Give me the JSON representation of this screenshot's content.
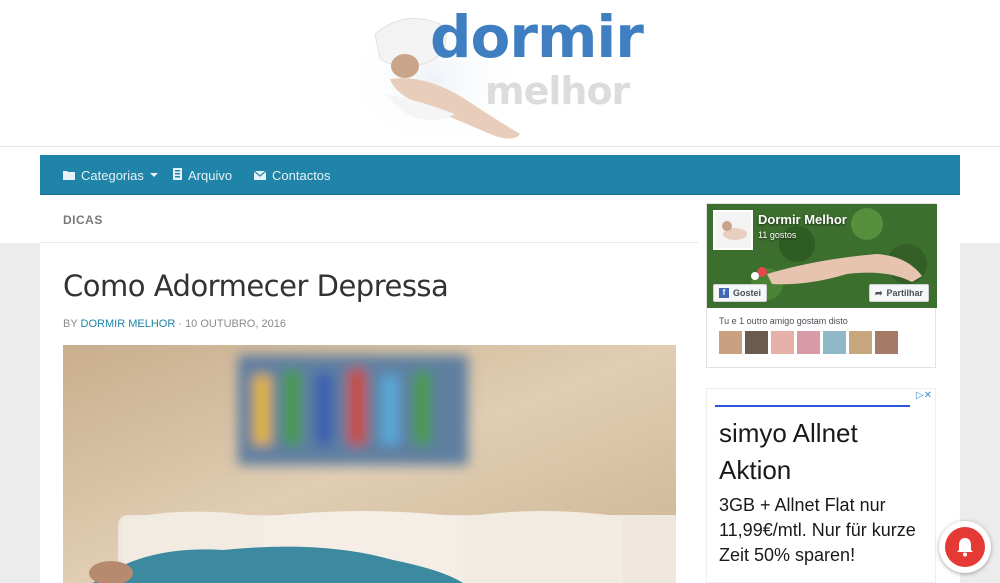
{
  "header": {
    "logo_word": "dormir",
    "logo_sub": "melhor"
  },
  "nav": {
    "items": [
      {
        "label": "Categorias",
        "icon": "folder-icon"
      },
      {
        "label": "Arquivo",
        "icon": "archive-icon"
      },
      {
        "label": "Contactos",
        "icon": "envelope-icon"
      }
    ]
  },
  "breadcrumb": "DICAS",
  "post": {
    "title": "Como Adormecer Depressa",
    "by": "BY",
    "author": "DORMIR MELHOR",
    "date": "· 10 OUTUBRO, 2016"
  },
  "facebook": {
    "page_name": "Dormir Melhor",
    "likes": "11 gostos",
    "like_button": "Gostei",
    "share_button": "Partilhar",
    "friends_text": "Tu e 1 outro amigo gostam disto"
  },
  "ad": {
    "title": "simyo Allnet Aktion",
    "body": "3GB + Allnet Flat nur 11,99€/mtl. Nur für kurze Zeit 50% sparen!",
    "close": "▷✕"
  },
  "colors": {
    "nav_bg": "#1f84a8",
    "link": "#1f84a8",
    "logo_blue": "#3f7fc1",
    "bell_red": "#e53935"
  }
}
